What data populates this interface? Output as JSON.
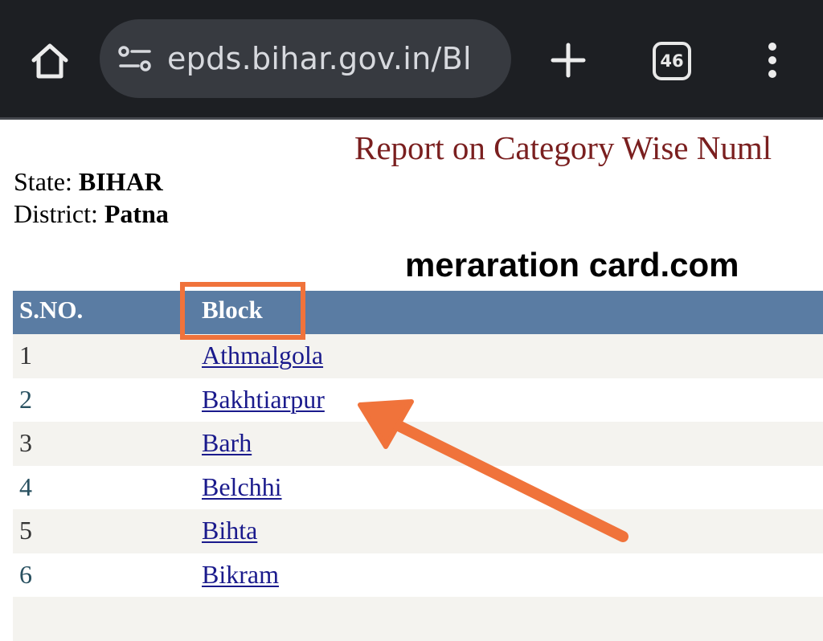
{
  "browser": {
    "url": "epds.bihar.gov.in/Bl",
    "tab_count": "46"
  },
  "page": {
    "title": "Report on Category Wise Numl",
    "state_label": "State:",
    "state_value": "BIHAR",
    "district_label": "District:",
    "district_value": "Patna",
    "watermark": "meraration card.com"
  },
  "table": {
    "headers": {
      "sno": "S.NO.",
      "block": "Block"
    },
    "rows": [
      {
        "sno": "1",
        "block": "Athmalgola"
      },
      {
        "sno": "2",
        "block": "Bakhtiarpur"
      },
      {
        "sno": "3",
        "block": "Barh"
      },
      {
        "sno": "4",
        "block": "Belchhi"
      },
      {
        "sno": "5",
        "block": "Bihta"
      },
      {
        "sno": "6",
        "block": "Bikram"
      }
    ]
  },
  "colors": {
    "chrome_bg": "#1d1f23",
    "title": "#7a1f1f",
    "header_bg": "#5a7ca3",
    "link": "#1a1a8c",
    "annotation": "#f0733b"
  }
}
